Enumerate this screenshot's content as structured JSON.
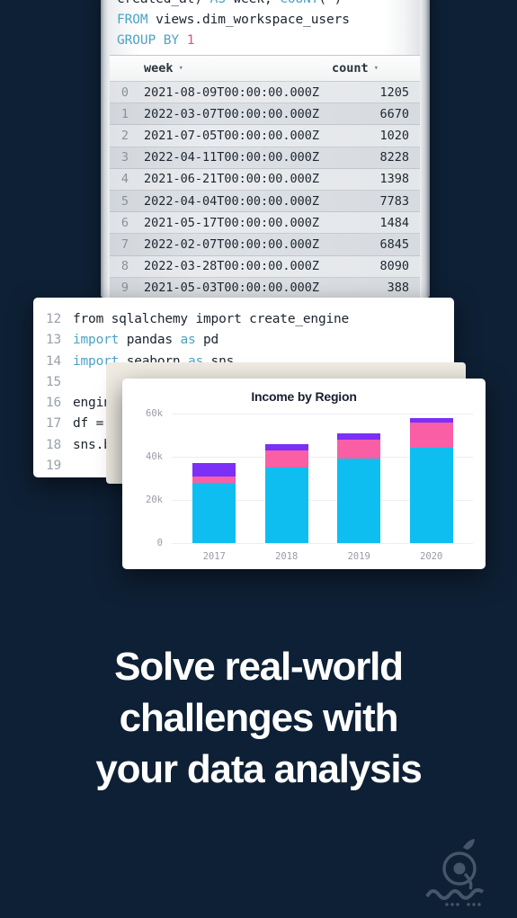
{
  "background_color": "#0e2035",
  "sql_panel": {
    "code_lines": [
      {
        "segments": [
          {
            "t": "created_at) ",
            "c": "plain"
          },
          {
            "t": "AS",
            "c": "kw"
          },
          {
            "t": " week, ",
            "c": "plain"
          },
          {
            "t": "COUNT",
            "c": "kw"
          },
          {
            "t": "(*)",
            "c": "plain"
          }
        ]
      },
      {
        "segments": [
          {
            "t": "FROM",
            "c": "kw"
          },
          {
            "t": " views.dim_workspace_users",
            "c": "plain"
          }
        ]
      },
      {
        "segments": [
          {
            "t": "GROUP BY",
            "c": "kw"
          },
          {
            "t": " ",
            "c": "plain"
          },
          {
            "t": "1",
            "c": "num"
          }
        ]
      }
    ],
    "table": {
      "columns": [
        "week",
        "count"
      ],
      "rows": [
        {
          "index": "0",
          "week": "2021-08-09T00:00:00.000Z",
          "count": "1205"
        },
        {
          "index": "1",
          "week": "2022-03-07T00:00:00.000Z",
          "count": "6670"
        },
        {
          "index": "2",
          "week": "2021-07-05T00:00:00.000Z",
          "count": "1020"
        },
        {
          "index": "3",
          "week": "2022-04-11T00:00:00.000Z",
          "count": "8228"
        },
        {
          "index": "4",
          "week": "2021-06-21T00:00:00.000Z",
          "count": "1398"
        },
        {
          "index": "5",
          "week": "2022-04-04T00:00:00.000Z",
          "count": "7783"
        },
        {
          "index": "6",
          "week": "2021-05-17T00:00:00.000Z",
          "count": "1484"
        },
        {
          "index": "7",
          "week": "2022-02-07T00:00:00.000Z",
          "count": "6845"
        },
        {
          "index": "8",
          "week": "2022-03-28T00:00:00.000Z",
          "count": "8090"
        },
        {
          "index": "9",
          "week": "2021-05-03T00:00:00.000Z",
          "count": "388"
        }
      ]
    }
  },
  "code_panel": {
    "lines": [
      {
        "num": "12",
        "segments": [
          {
            "t": "from sqlalchemy import create_engine",
            "c": "plain"
          }
        ]
      },
      {
        "num": "13",
        "segments": [
          {
            "t": "import",
            "c": "kw"
          },
          {
            "t": " pandas ",
            "c": "plain"
          },
          {
            "t": "as",
            "c": "kw"
          },
          {
            "t": " pd",
            "c": "plain"
          }
        ]
      },
      {
        "num": "14",
        "segments": [
          {
            "t": "import",
            "c": "kw"
          },
          {
            "t": " seaborn ",
            "c": "plain"
          },
          {
            "t": "as",
            "c": "kw"
          },
          {
            "t": " sns",
            "c": "plain"
          }
        ]
      },
      {
        "num": "15",
        "segments": []
      },
      {
        "num": "16",
        "segments": [
          {
            "t": "engine = ",
            "c": "plain"
          }
        ]
      },
      {
        "num": "17",
        "segments": [
          {
            "t": "df = pd.",
            "c": "plain"
          }
        ]
      },
      {
        "num": "18",
        "segments": [
          {
            "t": "sns.barp",
            "c": "plain"
          }
        ]
      },
      {
        "num": "19",
        "segments": []
      }
    ]
  },
  "chart_data": {
    "type": "bar",
    "title": "Income by Region",
    "xlabel": "",
    "ylabel": "",
    "categories": [
      "2017",
      "2018",
      "2019",
      "2020"
    ],
    "ylim": [
      0,
      60000
    ],
    "yticks": [
      0,
      20000,
      40000,
      60000
    ],
    "ytick_labels": [
      "0",
      "20k",
      "40k",
      "60k"
    ],
    "grid": true,
    "legend_position": "none",
    "stacked": true,
    "series": [
      {
        "name": "series-1",
        "color": "#0ebef0",
        "values": [
          28000,
          35000,
          39000,
          44000
        ]
      },
      {
        "name": "series-2",
        "color": "#fa5fa5",
        "values": [
          3000,
          8000,
          9000,
          12000
        ]
      },
      {
        "name": "series-3",
        "color": "#7b2ff7",
        "values": [
          6000,
          3000,
          3000,
          2000
        ]
      }
    ]
  },
  "headline": {
    "line1": "Solve real-world",
    "line2": "challenges with",
    "line3": "your data analysis"
  },
  "watermark": {
    "name": "sarzamin-download-logo"
  }
}
